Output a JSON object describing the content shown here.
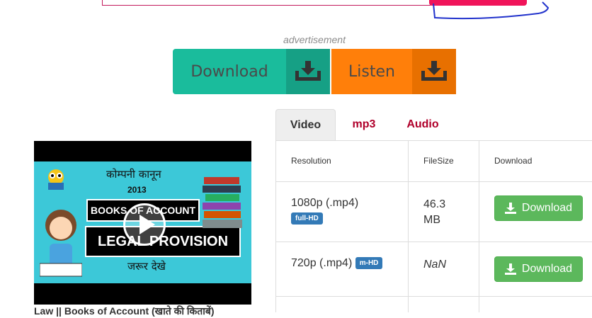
{
  "ad": {
    "label": "advertisement"
  },
  "promo": {
    "download_label": "Download",
    "download_icon": "download-tray-icon",
    "listen_label": "Listen",
    "listen_icon": "download-tray-icon",
    "colors": {
      "download": "#1abc9c",
      "listen": "#ff7f0a"
    }
  },
  "video": {
    "thumbnail_text": {
      "top_hindi": "कोम्पनी कानून",
      "year": "2013",
      "books": "BOOKS OF ACCOUNT",
      "legal": "LEGAL PROVISION",
      "bottom_hindi": "जरूर देखे"
    },
    "caption": "Law || Books of Account (खाते की किताबें)"
  },
  "tabs": [
    {
      "label": "Video",
      "active": true
    },
    {
      "label": "mp3",
      "active": false
    },
    {
      "label": "Audio",
      "active": false
    }
  ],
  "table": {
    "headers": [
      "Resolution",
      "FileSize",
      "Download"
    ],
    "rows": [
      {
        "resolution": "1080p (.mp4)",
        "badge": "full-HD",
        "size": "46.3 MB",
        "button": "Download"
      },
      {
        "resolution": "720p (.mp4)",
        "badge": "m-HD",
        "size": "NaN",
        "button": "Download"
      }
    ]
  }
}
